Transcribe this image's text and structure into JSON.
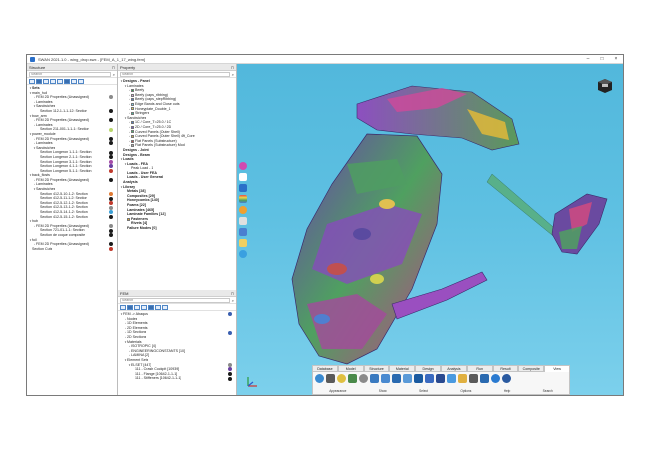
{
  "window": {
    "title": "SWAN 2021.1.0 - wing_drop.swx - [FEM_A_1_17_wing.fem]"
  },
  "structure": {
    "title": "Structure",
    "search_placeholder": "Search",
    "rows": [
      {
        "text": "Sets",
        "level": 0,
        "bold": true,
        "tw": "▾"
      },
      {
        "text": "main_hull",
        "level": 0,
        "tw": "▾"
      },
      {
        "text": "FEM 2D Properties (Unassigned)",
        "level": 1,
        "tw": "›",
        "color": "#8a8a8a"
      },
      {
        "text": "Laminates",
        "level": 1,
        "tw": "›"
      },
      {
        "text": "Sandwiches",
        "level": 1,
        "tw": "▾"
      },
      {
        "text": "Section 112-1-1-1-12: Section",
        "level": 2,
        "color": "#1a1a1a"
      },
      {
        "text": "bow_arm",
        "level": 0,
        "tw": "▾"
      },
      {
        "text": "FEM 2D Properties (Unassigned)",
        "level": 1,
        "tw": "›",
        "color": "#1a1a1a"
      },
      {
        "text": "Laminates",
        "level": 1,
        "tw": "›"
      },
      {
        "text": "Section 211-001-1-1-1: Section",
        "level": 2,
        "color": "#b8d66a"
      },
      {
        "text": "power_module",
        "level": 0,
        "tw": "▾"
      },
      {
        "text": "FEM 2D Properties (Unassigned)",
        "level": 1,
        "tw": "›",
        "color": "#1a1a1a"
      },
      {
        "text": "Laminates",
        "level": 1,
        "tw": "›",
        "color": "#1a1a1a"
      },
      {
        "text": "Sandwiches",
        "level": 1,
        "tw": "▾"
      },
      {
        "text": "Section Longeron 1-1-1: Section",
        "level": 2,
        "color": "#1a1a1a"
      },
      {
        "text": "Section Longeron 2-1-1: Section",
        "level": 2,
        "color": "#1a1a1a"
      },
      {
        "text": "Section Longeron 3-1-1: Section",
        "level": 2,
        "color": "#a54ba8"
      },
      {
        "text": "Section Longeron 4-1-1: Section",
        "level": 2,
        "color": "#6a3fa0"
      },
      {
        "text": "Section Longeron 5-1-1: Section",
        "level": 2,
        "color": "#c0392b"
      },
      {
        "text": "back_flosts",
        "level": 0,
        "tw": "▾"
      },
      {
        "text": "FEM 2D Properties (Unassigned)",
        "level": 1,
        "tw": "›",
        "color": "#1a1a1a"
      },
      {
        "text": "Laminates",
        "level": 1,
        "tw": "›"
      },
      {
        "text": "Sandwiches",
        "level": 1,
        "tw": "▾"
      },
      {
        "text": "Section 412-5-10-1-2: Section",
        "level": 2,
        "color": "#e07a33"
      },
      {
        "text": "Section 412-5-11-1-2: Section",
        "level": 2,
        "color": "#1a1a1a"
      },
      {
        "text": "Section 412-5-12-1-2: Section",
        "level": 2,
        "color": "#c0392b"
      },
      {
        "text": "Section 412-5-13-1-2: Section",
        "level": 2,
        "color": "#8a8a8a"
      },
      {
        "text": "Section 412-5-14-1-2: Section",
        "level": 2,
        "color": "#3a9fd6"
      },
      {
        "text": "Section 412-5-15-1-2: Section",
        "level": 2,
        "color": "#1a1a1a"
      },
      {
        "text": "hub",
        "level": 0,
        "tw": "▾"
      },
      {
        "text": "FEM 2D Properties (Unassigned)",
        "level": 1,
        "tw": "›",
        "color": "#8a8a8a"
      },
      {
        "text": "Section 721-01-1-1: Section",
        "level": 2,
        "color": "#1a1a1a"
      },
      {
        "text": "Section de coque composite",
        "level": 2,
        "color": "#1a1a1a"
      },
      {
        "text": "foil",
        "level": 0,
        "tw": "▾"
      },
      {
        "text": "FEM 2D Properties (Unassigned)",
        "level": 1,
        "tw": "›",
        "color": "#1a1a1a"
      },
      {
        "text": "Section Cuts",
        "level": 0,
        "color": "#c0392b"
      }
    ]
  },
  "property": {
    "title": "Property",
    "search_placeholder": "Search",
    "rows": [
      {
        "text": "Designs - Panel",
        "level": 0,
        "bold": true,
        "tw": "▾"
      },
      {
        "text": "Laminates",
        "level": 1,
        "tw": "▾"
      },
      {
        "text": "Beefy",
        "level": 2,
        "tw": "›",
        "sq": "#2aa34a"
      },
      {
        "text": "Beefy (caps_ribbing)",
        "level": 2,
        "tw": "›",
        "sq": "#d9a6d9"
      },
      {
        "text": "Beefy (caps_stepRibbing)",
        "level": 2,
        "tw": "›",
        "sq": "#4e7fd0"
      },
      {
        "text": "Edge Bands and Close outs",
        "level": 2,
        "tw": "›",
        "sq": "#7ad0f0"
      },
      {
        "text": "Honeyplate_Double_1",
        "level": 2,
        "tw": "›",
        "sq": "#e8d84a"
      },
      {
        "text": "Stringers",
        "level": 2,
        "tw": "›",
        "sq": "#3fbf9a"
      },
      {
        "text": "Sandwiches",
        "level": 1,
        "tw": "▾"
      },
      {
        "text": "1C / Core_T=25.0 / 1C",
        "level": 2,
        "tw": "›",
        "sq": "#4e7fd0"
      },
      {
        "text": "2D / Core_T=25.0 / 2D",
        "level": 2,
        "tw": "›",
        "sq": "#7a4fd0"
      },
      {
        "text": "Curved Panels (Outer Shell)",
        "level": 2,
        "tw": "›",
        "sq": "#3fbf6a"
      },
      {
        "text": "Curved Panels (Outer Shell) 4ft_Core",
        "level": 2,
        "tw": "›",
        "sq": "#c9b04a"
      },
      {
        "text": "Flat Panels (Substructure)",
        "level": 2,
        "tw": "›",
        "sq": "#c04a4a"
      },
      {
        "text": "Flat Panels (Substructure) Mod",
        "level": 2,
        "tw": "›",
        "sq": "#b0b0b0"
      },
      {
        "text": "Designs - Joint",
        "level": 0,
        "bold": true
      },
      {
        "text": "Designs - Beam",
        "level": 0,
        "bold": true
      },
      {
        "text": "Loads",
        "level": 0,
        "bold": true,
        "tw": "▾"
      },
      {
        "text": "Loads - FEA",
        "level": 1,
        "bold": true,
        "tw": "▾"
      },
      {
        "text": "Peak Load - 1",
        "level": 2
      },
      {
        "text": "Loads - User FEA",
        "level": 1,
        "bold": true
      },
      {
        "text": "Loads - User General",
        "level": 1,
        "bold": true
      },
      {
        "text": "Analysis",
        "level": 0,
        "bold": true
      },
      {
        "text": "Library",
        "level": 0,
        "bold": true,
        "tw": "▾"
      },
      {
        "text": "Metals [28]",
        "level": 1,
        "bold": true
      },
      {
        "text": "Composites [29]",
        "level": 1,
        "bold": true
      },
      {
        "text": "Honeycombs [140]",
        "level": 1,
        "bold": true
      },
      {
        "text": "Foams [22]",
        "level": 1,
        "bold": true
      },
      {
        "text": "Laminates [465]",
        "level": 1,
        "bold": true
      },
      {
        "text": "Laminate Families [12]",
        "level": 1,
        "bold": true
      },
      {
        "text": "Fasteners",
        "level": 1,
        "bold": true,
        "sq": "#e8b030"
      },
      {
        "text": "Rivets [4]",
        "level": 2,
        "bold": true
      },
      {
        "text": "Failure Modes [0]",
        "level": 1,
        "bold": true
      }
    ]
  },
  "fem": {
    "title": "FEM",
    "search_placeholder": "Search",
    "rows": [
      {
        "text": "FEM -> Abaqus",
        "level": 0,
        "tw": "▾",
        "color": "#3a5fb0"
      },
      {
        "text": "Nodes",
        "level": 1,
        "tw": "›"
      },
      {
        "text": "1D Elements",
        "level": 1,
        "tw": "›"
      },
      {
        "text": "2D Elements",
        "level": 1,
        "tw": "›"
      },
      {
        "text": "1D Sections",
        "level": 1,
        "tw": "›",
        "color": "#3a5fb0"
      },
      {
        "text": "2D Sections",
        "level": 1,
        "tw": "›"
      },
      {
        "text": "Materials",
        "level": 1,
        "tw": "▾"
      },
      {
        "text": "ISOTROPIC [4]",
        "level": 2,
        "tw": "›"
      },
      {
        "text": "ENGINEERINGCONSTANTS [10]",
        "level": 2,
        "tw": "›"
      },
      {
        "text": "LAMINA [2]",
        "level": 2,
        "tw": "›"
      },
      {
        "text": "Element Sets",
        "level": 1,
        "tw": "▾"
      },
      {
        "text": "ELSET [447]",
        "level": 2,
        "tw": "▾",
        "color": "#8a8a8a"
      },
      {
        "text": "111 - Crash Cockpit [10939]",
        "level": 3,
        "color": "#6a3fa0"
      },
      {
        "text": "111 - Flange [10642-1-1-1]",
        "level": 3,
        "color": "#1a1a1a"
      },
      {
        "text": "111 - Stiffeners [10642-1-1-1]",
        "level": 3,
        "color": "#1a1a1a"
      }
    ]
  },
  "ribbon": {
    "tabs": [
      "Database",
      "Model",
      "Structure",
      "Material",
      "Design",
      "Analysis",
      "Run",
      "Result",
      "Composite",
      "View"
    ],
    "active_tab": "View",
    "groups": [
      "Appearance",
      "Show",
      "Select",
      "Options",
      "Help",
      "Search"
    ]
  },
  "colors": {
    "viewport_top": "#52b8dc",
    "accent": "#2a6fc9"
  }
}
